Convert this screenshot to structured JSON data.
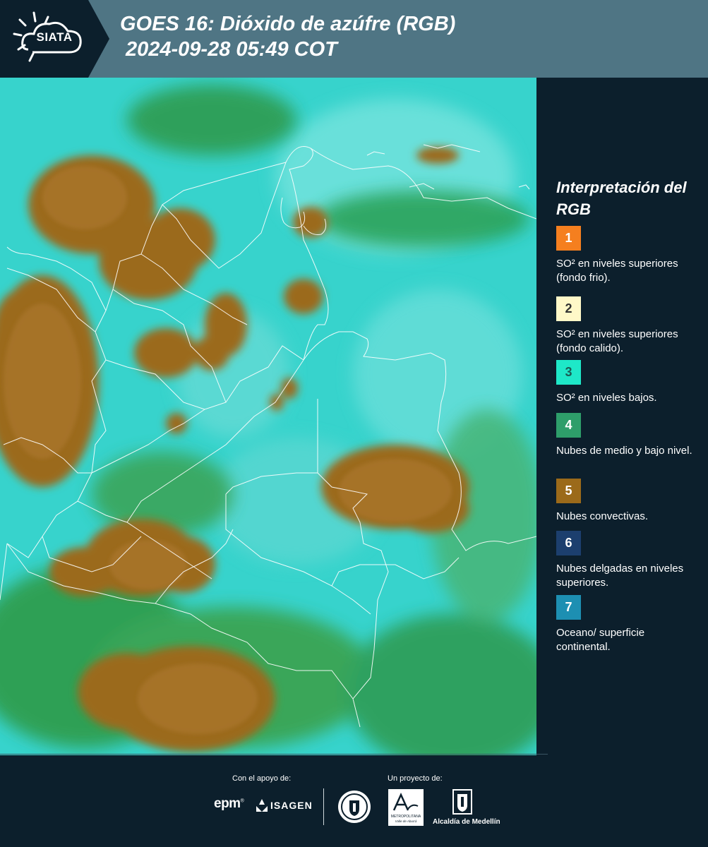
{
  "header": {
    "logo_text": "SIATA",
    "title_line1": "GOES 16: Dióxido de azúfre (RGB)",
    "title_line2": "2024-09-28 05:49 COT"
  },
  "map": {
    "description_icon": "satellite-rgb-map"
  },
  "legend": {
    "title": "Interpretación del RGB",
    "items": [
      {
        "number": "1",
        "color": "#f57f1f",
        "number_color": "#ffffff",
        "text": "SO² en niveles superiores (fondo frio)."
      },
      {
        "number": "2",
        "color": "#fff8c8",
        "number_color": "#333333",
        "text": "SO² en niveles superiores (fondo calido)."
      },
      {
        "number": "3",
        "color": "#1ee8c8",
        "number_color": "#1b5c55",
        "text": "SO² en niveles bajos."
      },
      {
        "number": "4",
        "color": "#2e9e6a",
        "number_color": "#ffffff",
        "text": "Nubes de medio y bajo nivel."
      },
      {
        "number": "5",
        "color": "#9b6a1a",
        "number_color": "#ffffff",
        "text": "Nubes convectivas."
      },
      {
        "number": "6",
        "color": "#1c3f6e",
        "number_color": "#ffffff",
        "text": "Nubes delgadas en niveles superiores."
      },
      {
        "number": "7",
        "color": "#1d8fb2",
        "number_color": "#ffffff",
        "text": "Oceano/ superficie continental."
      }
    ]
  },
  "footer": {
    "support_label": "Con el apoyo de:",
    "project_label": "Un proyecto de:",
    "epm": "epm",
    "isagen": "ISAGEN",
    "area_text_1": "Área",
    "area_text_2": "METROPOLITANA",
    "area_text_3": "Valle de Aburrá",
    "alcaldia": "Alcaldía de Medellín"
  }
}
